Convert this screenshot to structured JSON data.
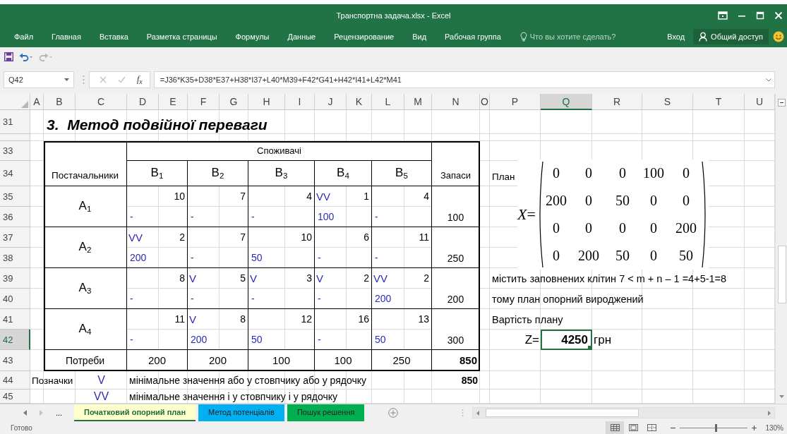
{
  "window": {
    "title": "Транспортна задача.xlsx - Excel"
  },
  "ribbon": {
    "tabs": [
      {
        "label": "Файл",
        "selected": false
      },
      {
        "label": "Главная",
        "selected": false
      },
      {
        "label": "Вставка",
        "selected": false
      },
      {
        "label": "Разметка страницы",
        "selected": false
      },
      {
        "label": "Формулы",
        "selected": false
      },
      {
        "label": "Данные",
        "selected": false
      },
      {
        "label": "Рецензирование",
        "selected": false
      },
      {
        "label": "Вид",
        "selected": false
      },
      {
        "label": "Рабочая группа",
        "selected": false
      }
    ],
    "tell_me": {
      "placeholder": "Что вы хотите сделать?"
    },
    "sign_in": "Вход",
    "share": "Общий доступ"
  },
  "quick_access": {
    "undo": {
      "disabled": false
    },
    "redo": {
      "disabled": true
    }
  },
  "formula_bar": {
    "name_box": "Q42",
    "function_button": "f$_{x}$",
    "formula": "=J36*K35+D38*E37+H38*I37+L40*M39+F42*G41+H42*I41+L42*M41"
  },
  "sheet": {
    "columns": [
      {
        "label": "A",
        "selected": false
      },
      {
        "label": "B",
        "selected": false
      },
      {
        "label": "C",
        "selected": false
      },
      {
        "label": "D",
        "selected": false
      },
      {
        "label": "E",
        "selected": false
      },
      {
        "label": "F",
        "selected": false
      },
      {
        "label": "G",
        "selected": false
      },
      {
        "label": "H",
        "selected": false
      },
      {
        "label": "I",
        "selected": false
      },
      {
        "label": "J",
        "selected": false
      },
      {
        "label": "K",
        "selected": false
      },
      {
        "label": "L",
        "selected": false
      },
      {
        "label": "M",
        "selected": false
      },
      {
        "label": "N",
        "selected": false
      },
      {
        "label": "O",
        "selected": false
      },
      {
        "label": "P",
        "selected": false
      },
      {
        "label": "Q",
        "selected": true
      },
      {
        "label": "R",
        "selected": false
      },
      {
        "label": "S",
        "selected": false
      },
      {
        "label": "T",
        "selected": false
      },
      {
        "label": "U",
        "selected": false
      }
    ],
    "rows": [
      {
        "label": "31",
        "selected": false
      },
      {
        "label": "33",
        "selected": false
      },
      {
        "label": "34",
        "selected": false
      },
      {
        "label": "35",
        "selected": false
      },
      {
        "label": "36",
        "selected": false
      },
      {
        "label": "37",
        "selected": false
      },
      {
        "label": "38",
        "selected": false
      },
      {
        "label": "39",
        "selected": false
      },
      {
        "label": "40",
        "selected": false
      },
      {
        "label": "41",
        "selected": false
      },
      {
        "label": "42",
        "selected": true
      },
      {
        "label": "43",
        "selected": false
      },
      {
        "label": "44",
        "selected": false
      },
      {
        "label": "45",
        "selected": false
      }
    ],
    "title": "3.  Метод подвійної переваги",
    "transport_table": {
      "suppliers_label": "Постачальники",
      "consumers_label": "Споживачі",
      "stock_label": "Запаси",
      "demand_label": "Потреби",
      "consumers": [
        "B$_{1}$",
        "B$_{2}$",
        "B$_{3}$",
        "B$_{4}$",
        "B$_{5}$"
      ],
      "suppliers": [
        {
          "name": "A$_{1}$",
          "stock": "100",
          "cells": [
            {
              "cost": "10",
              "amount": "-"
            },
            {
              "cost": "7",
              "amount": "-"
            },
            {
              "cost": "4",
              "amount": "-"
            },
            {
              "mark": "VV",
              "cost": "1",
              "amount": "100"
            },
            {
              "cost": "4",
              "amount": "-"
            }
          ]
        },
        {
          "name": "A$_{2}$",
          "stock": "250",
          "cells": [
            {
              "mark": "VV",
              "cost": "2",
              "amount": "200"
            },
            {
              "cost": "7",
              "amount": "-"
            },
            {
              "cost": "10",
              "amount": "50"
            },
            {
              "cost": "6",
              "amount": "-"
            },
            {
              "cost": "11",
              "amount": "-"
            }
          ]
        },
        {
          "name": "A$_{3}$",
          "stock": "200",
          "cells": [
            {
              "cost": "8",
              "amount": "-"
            },
            {
              "mark": "V",
              "cost": "5",
              "amount": "-"
            },
            {
              "mark": "V",
              "cost": "3",
              "amount": "-"
            },
            {
              "mark": "V",
              "cost": "2",
              "amount": "-"
            },
            {
              "mark": "VV",
              "cost": "2",
              "amount": "200"
            }
          ]
        },
        {
          "name": "A$_{4}$",
          "stock": "300",
          "cells": [
            {
              "cost": "11",
              "amount": "-"
            },
            {
              "mark": "V",
              "cost": "8",
              "amount": "200"
            },
            {
              "cost": "12",
              "amount": "50"
            },
            {
              "cost": "16",
              "amount": "-"
            },
            {
              "cost": "13",
              "amount": "50"
            }
          ]
        }
      ],
      "demand": [
        "200",
        "200",
        "100",
        "100",
        "250"
      ],
      "total": "850"
    },
    "legend": {
      "label": "Позначки",
      "items": [
        {
          "symbol": "V",
          "text": "мінімальне значення або у стовпчику або у рядочку"
        },
        {
          "symbol": "VV",
          "text": "мінімальне значення і у стовпчику і у рядочку"
        }
      ],
      "check_total": "850"
    },
    "plan": {
      "label": "План",
      "matrix_label": "*X*=",
      "matrix": [
        [
          "0",
          "0",
          "0",
          "100",
          "0"
        ],
        [
          "200",
          "0",
          "50",
          "0",
          "0"
        ],
        [
          "0",
          "0",
          "0",
          "0",
          "200"
        ],
        [
          "0",
          "200",
          "50",
          "0",
          "50"
        ]
      ],
      "note_1": "містить заповнених клітин 7 < m + n – 1 =4+5-1=8",
      "note_2": "тому план опорний вироджений",
      "cost_label": "Вартість плану",
      "z_label": "Z=",
      "z_value": "4250",
      "z_active": true,
      "currency": "грн"
    }
  },
  "sheet_tabs": {
    "more": "...",
    "tabs": [
      {
        "label": "Початковий опорний план",
        "selected": true,
        "color": "#ffffcc"
      },
      {
        "label": "Метод потенціалів",
        "selected": false,
        "color": "#00b0f0"
      },
      {
        "label": "Пошук решення",
        "selected": false,
        "color": "#00b050"
      }
    ]
  },
  "status_bar": {
    "status": "Готово",
    "views": [
      {
        "kind": "normal",
        "selected": true
      },
      {
        "kind": "page_layout",
        "selected": false
      },
      {
        "kind": "page_break",
        "selected": false
      }
    ],
    "zoom": {
      "level": 0.53,
      "reading": "130%"
    }
  }
}
